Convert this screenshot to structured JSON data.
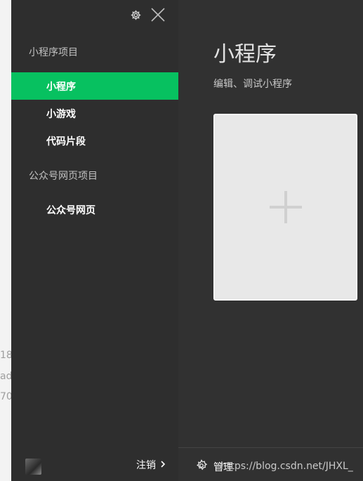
{
  "background": {
    "fragments": [
      "18",
      "ad",
      "70"
    ]
  },
  "sidebar": {
    "sections": [
      {
        "title": "小程序项目",
        "items": [
          {
            "label": "小程序",
            "active": true
          },
          {
            "label": "小游戏",
            "active": false
          },
          {
            "label": "代码片段",
            "active": false
          }
        ]
      },
      {
        "title": "公众号网页项目",
        "items": [
          {
            "label": "公众号网页",
            "active": false
          }
        ]
      }
    ],
    "logout_label": "注销",
    "top_icons": [
      "gear-icon",
      "close-icon"
    ]
  },
  "main": {
    "title": "小程序",
    "subtitle": "编辑、调试小程序",
    "new_card_icon": "plus-icon",
    "manage_label": "管理",
    "watermark": "https://blog.csdn.net/JHXL_"
  },
  "colors": {
    "accent": "#07c160",
    "sidebar_bg": "#2e2e2e",
    "main_bg": "#313131",
    "card_bg": "#e8e8e8"
  }
}
